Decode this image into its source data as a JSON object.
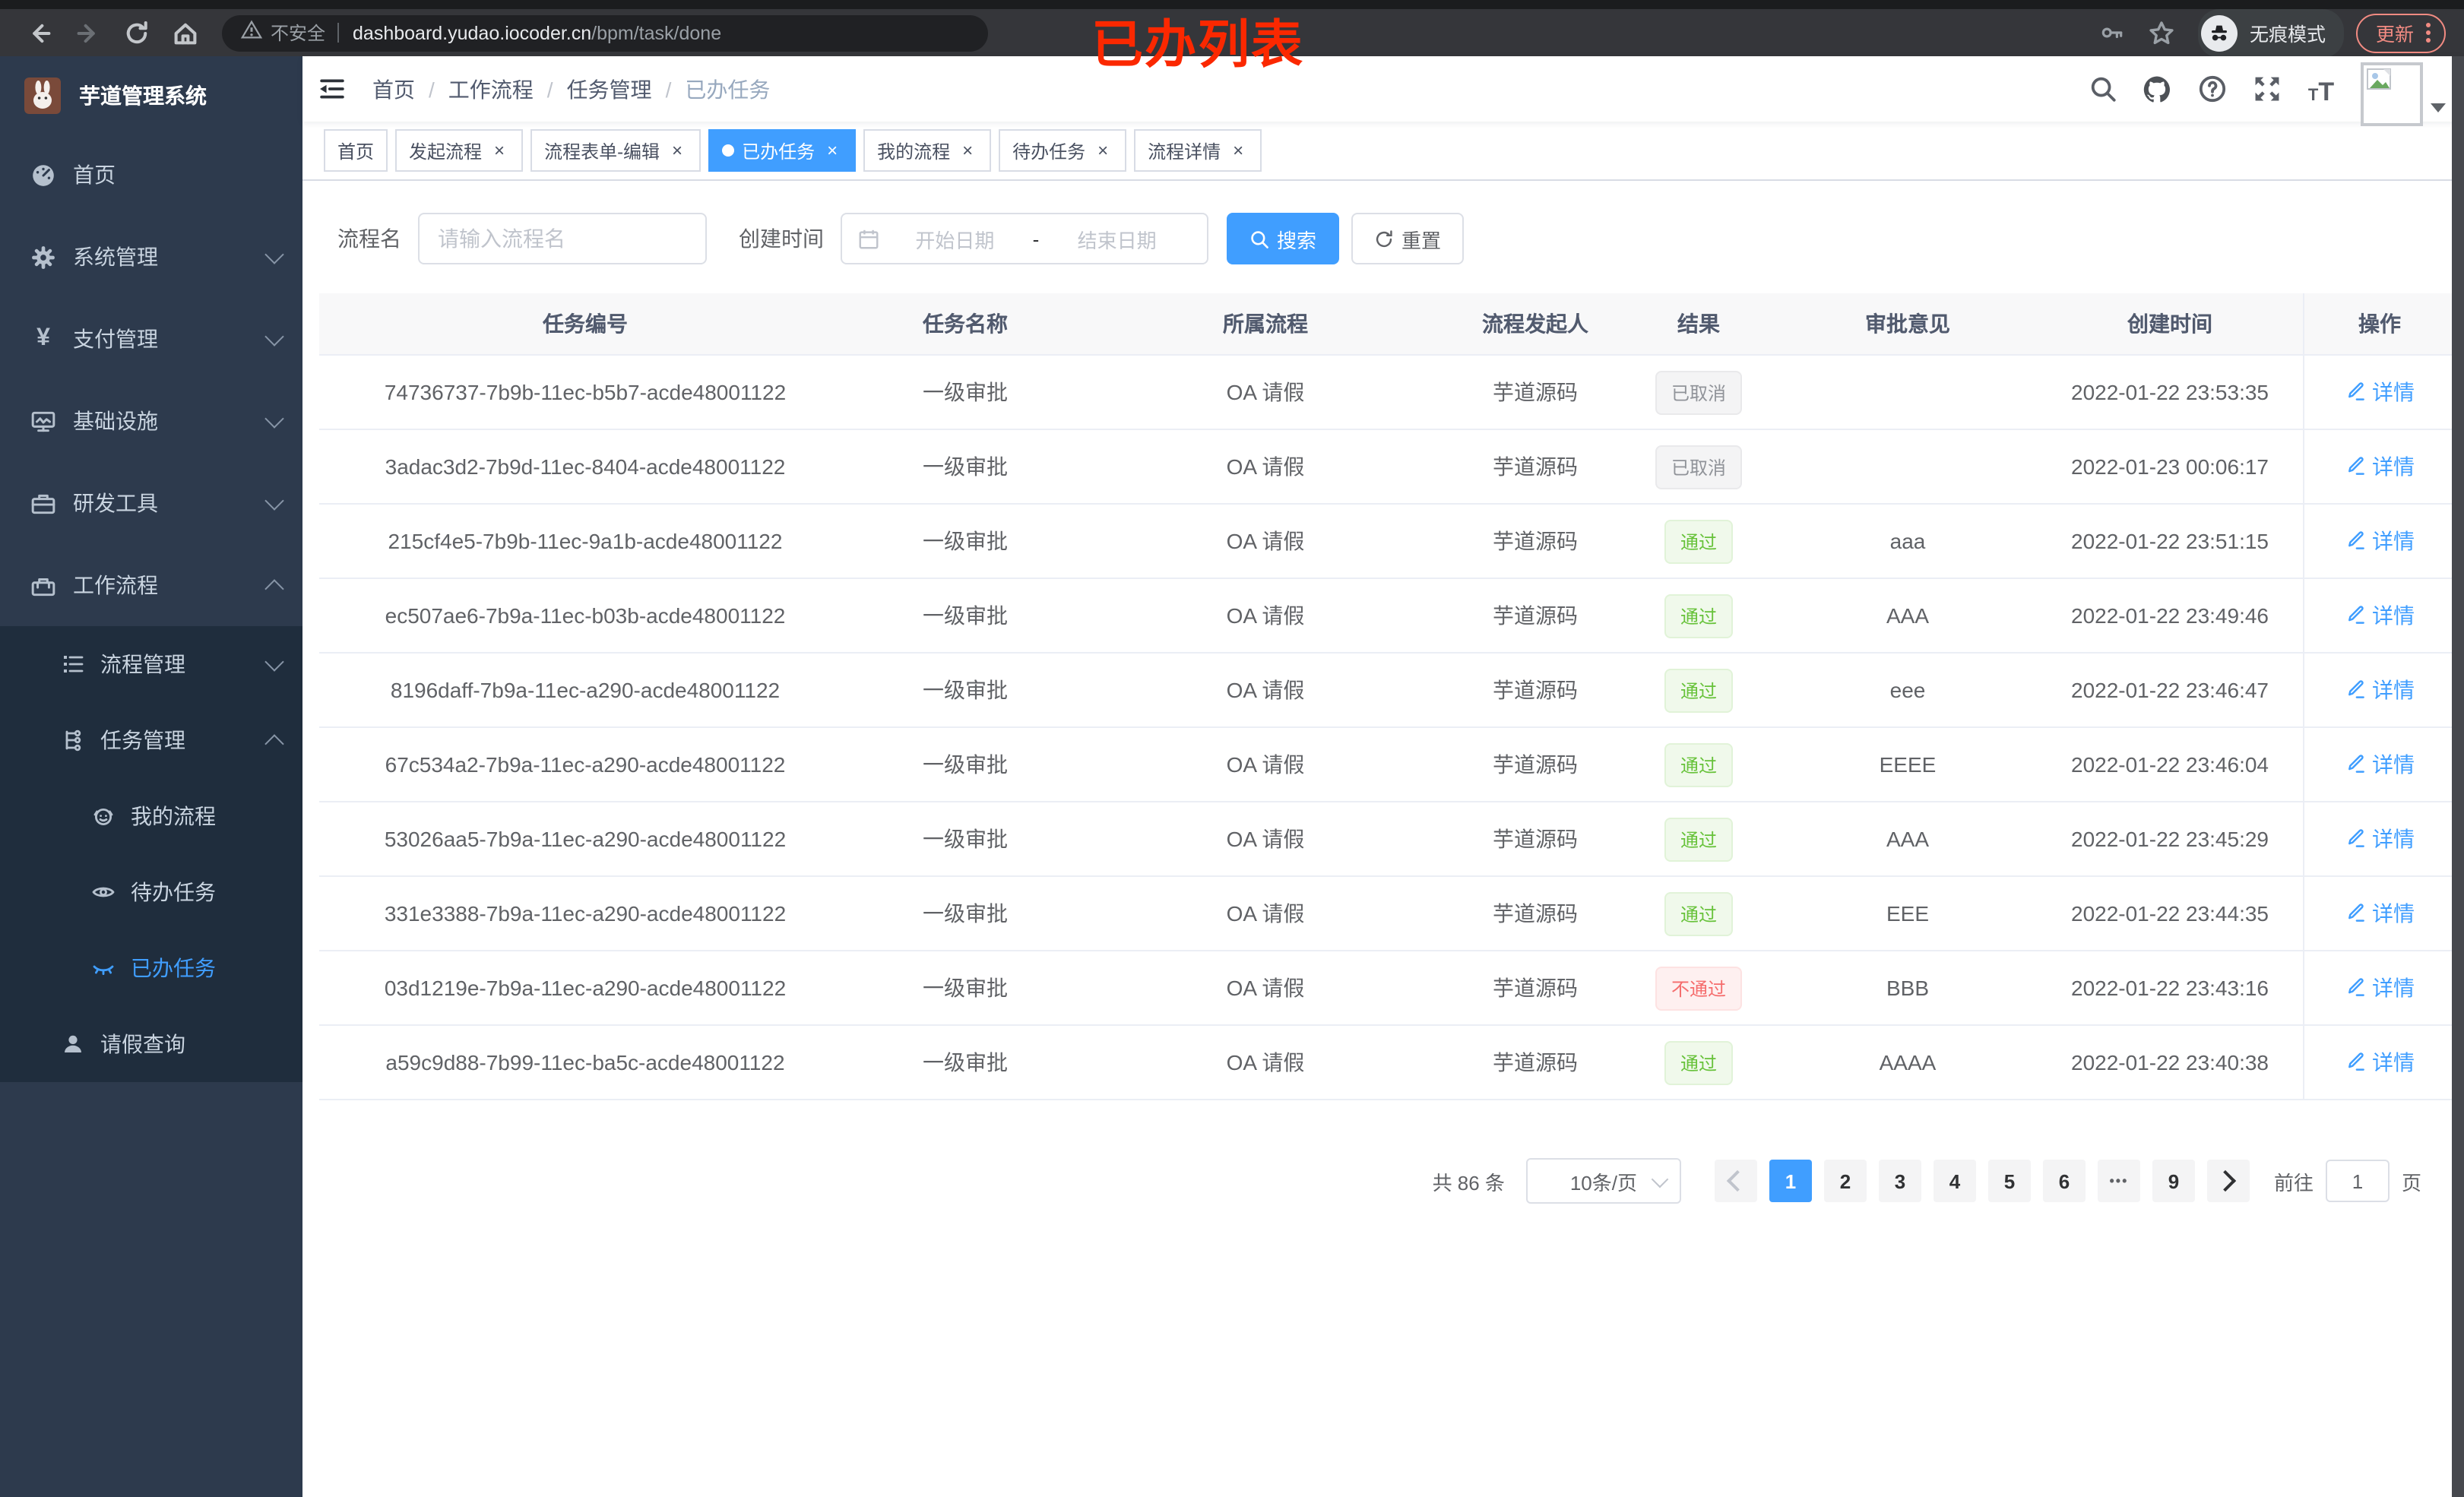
{
  "browser": {
    "security_label": "不安全",
    "url_host": "dashboard.yudao.iocoder.cn",
    "url_path": "/bpm/task/done",
    "incognito_label": "无痕模式",
    "update_label": "更新"
  },
  "annotation": "已办列表",
  "ui": {
    "close_glyph": "×",
    "breadcrumb_separator": "/",
    "yen_glyph": "¥",
    "font_small": "T",
    "font_large": "T",
    "question_glyph": "?"
  },
  "colors": {
    "accent": "#409EFF",
    "success": "#67C23A",
    "danger": "#F56C6C",
    "info": "#909399",
    "sidebar_bg": "#2d3a4d",
    "submenu_bg": "#1f2d3d"
  },
  "sidebar": {
    "app_title": "芋道管理系统",
    "items": [
      {
        "label": "首页"
      },
      {
        "label": "系统管理"
      },
      {
        "label": "支付管理"
      },
      {
        "label": "基础设施"
      },
      {
        "label": "研发工具"
      },
      {
        "label": "工作流程"
      },
      {
        "label": "流程管理"
      },
      {
        "label": "任务管理"
      },
      {
        "label": "我的流程"
      },
      {
        "label": "待办任务"
      },
      {
        "label": "已办任务"
      },
      {
        "label": "请假查询"
      }
    ]
  },
  "breadcrumb": {
    "items": [
      {
        "label": "首页"
      },
      {
        "label": "工作流程"
      },
      {
        "label": "任务管理"
      },
      {
        "label": "已办任务"
      }
    ]
  },
  "tabs": [
    {
      "label": "首页"
    },
    {
      "label": "发起流程"
    },
    {
      "label": "流程表单-编辑"
    },
    {
      "label": "已办任务"
    },
    {
      "label": "我的流程"
    },
    {
      "label": "待办任务"
    },
    {
      "label": "流程详情"
    }
  ],
  "filter": {
    "name_label": "流程名",
    "name_placeholder": "请输入流程名",
    "date_label": "创建时间",
    "date_start_placeholder": "开始日期",
    "date_separator": "-",
    "date_end_placeholder": "结束日期",
    "search_label": "搜索",
    "reset_label": "重置"
  },
  "table": {
    "columns": [
      {
        "label": "任务编号"
      },
      {
        "label": "任务名称"
      },
      {
        "label": "所属流程"
      },
      {
        "label": "流程发起人"
      },
      {
        "label": "结果"
      },
      {
        "label": "审批意见"
      },
      {
        "label": "创建时间"
      },
      {
        "label": "操作"
      }
    ],
    "action_label": "详情",
    "rows": [
      {
        "id": "74736737-7b9b-11ec-b5b7-acde48001122",
        "name": "一级审批",
        "process": "OA 请假",
        "starter": "芋道源码",
        "result": "已取消",
        "comment": "",
        "created": "2022-01-22 23:53:35"
      },
      {
        "id": "3adac3d2-7b9d-11ec-8404-acde48001122",
        "name": "一级审批",
        "process": "OA 请假",
        "starter": "芋道源码",
        "result": "已取消",
        "comment": "",
        "created": "2022-01-23 00:06:17"
      },
      {
        "id": "215cf4e5-7b9b-11ec-9a1b-acde48001122",
        "name": "一级审批",
        "process": "OA 请假",
        "starter": "芋道源码",
        "result": "通过",
        "comment": "aaa",
        "created": "2022-01-22 23:51:15"
      },
      {
        "id": "ec507ae6-7b9a-11ec-b03b-acde48001122",
        "name": "一级审批",
        "process": "OA 请假",
        "starter": "芋道源码",
        "result": "通过",
        "comment": "AAA",
        "created": "2022-01-22 23:49:46"
      },
      {
        "id": "8196daff-7b9a-11ec-a290-acde48001122",
        "name": "一级审批",
        "process": "OA 请假",
        "starter": "芋道源码",
        "result": "通过",
        "comment": "eee",
        "created": "2022-01-22 23:46:47"
      },
      {
        "id": "67c534a2-7b9a-11ec-a290-acde48001122",
        "name": "一级审批",
        "process": "OA 请假",
        "starter": "芋道源码",
        "result": "通过",
        "comment": "EEEE",
        "created": "2022-01-22 23:46:04"
      },
      {
        "id": "53026aa5-7b9a-11ec-a290-acde48001122",
        "name": "一级审批",
        "process": "OA 请假",
        "starter": "芋道源码",
        "result": "通过",
        "comment": "AAA",
        "created": "2022-01-22 23:45:29"
      },
      {
        "id": "331e3388-7b9a-11ec-a290-acde48001122",
        "name": "一级审批",
        "process": "OA 请假",
        "starter": "芋道源码",
        "result": "通过",
        "comment": "EEE",
        "created": "2022-01-22 23:44:35"
      },
      {
        "id": "03d1219e-7b9a-11ec-a290-acde48001122",
        "name": "一级审批",
        "process": "OA 请假",
        "starter": "芋道源码",
        "result": "不通过",
        "comment": "BBB",
        "created": "2022-01-22 23:43:16"
      },
      {
        "id": "a59c9d88-7b99-11ec-ba5c-acde48001122",
        "name": "一级审批",
        "process": "OA 请假",
        "starter": "芋道源码",
        "result": "通过",
        "comment": "AAAA",
        "created": "2022-01-22 23:40:38"
      }
    ]
  },
  "pagination": {
    "total_label": "共 86 条",
    "page_size": "10条/页",
    "pages": [
      "1",
      "2",
      "3",
      "4",
      "5",
      "6",
      "•••",
      "9"
    ],
    "goto_label": "前往",
    "goto_value": "1",
    "goto_suffix": "页"
  }
}
